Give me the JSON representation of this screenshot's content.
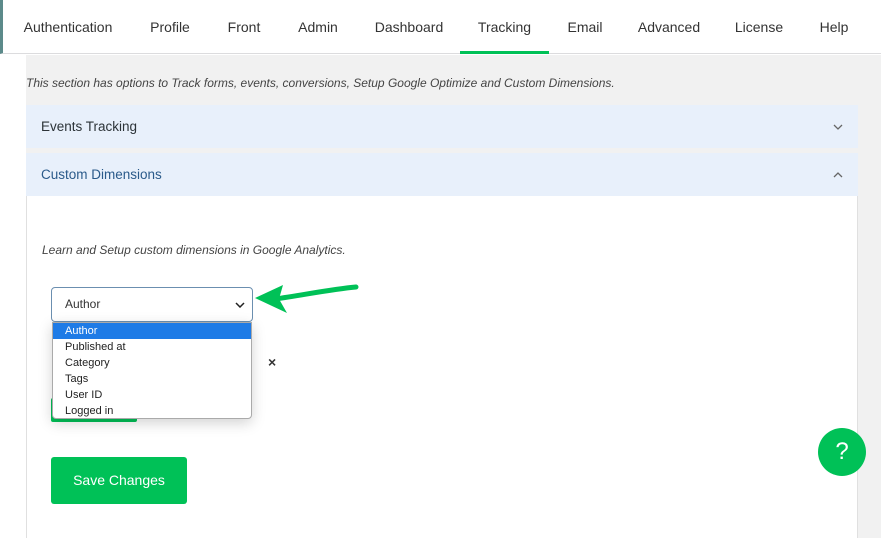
{
  "tabs": [
    {
      "label": "Authentication"
    },
    {
      "label": "Profile"
    },
    {
      "label": "Front"
    },
    {
      "label": "Admin"
    },
    {
      "label": "Dashboard"
    },
    {
      "label": "Tracking",
      "active": true
    },
    {
      "label": "Email"
    },
    {
      "label": "Advanced"
    },
    {
      "label": "License"
    },
    {
      "label": "Help"
    }
  ],
  "intro_text": "This section has options to Track forms, events, conversions, Setup Google Optimize and Custom Dimensions.",
  "accordions": [
    {
      "title": "Events Tracking",
      "expanded": false
    },
    {
      "title": "Custom Dimensions",
      "expanded": true
    }
  ],
  "custom_dimensions": {
    "learn_text": "Learn and Setup custom dimensions in Google Analytics.",
    "select_value": "Author",
    "options": [
      "Author",
      "Published at",
      "Category",
      "Tags",
      "User ID",
      "Logged in"
    ],
    "remove_symbol": "×"
  },
  "save_label": "Save Changes",
  "help_label": "?",
  "colors": {
    "accent": "#00c157",
    "accordion_bg": "#e8f0fb",
    "selected_option": "#1e7be6"
  }
}
